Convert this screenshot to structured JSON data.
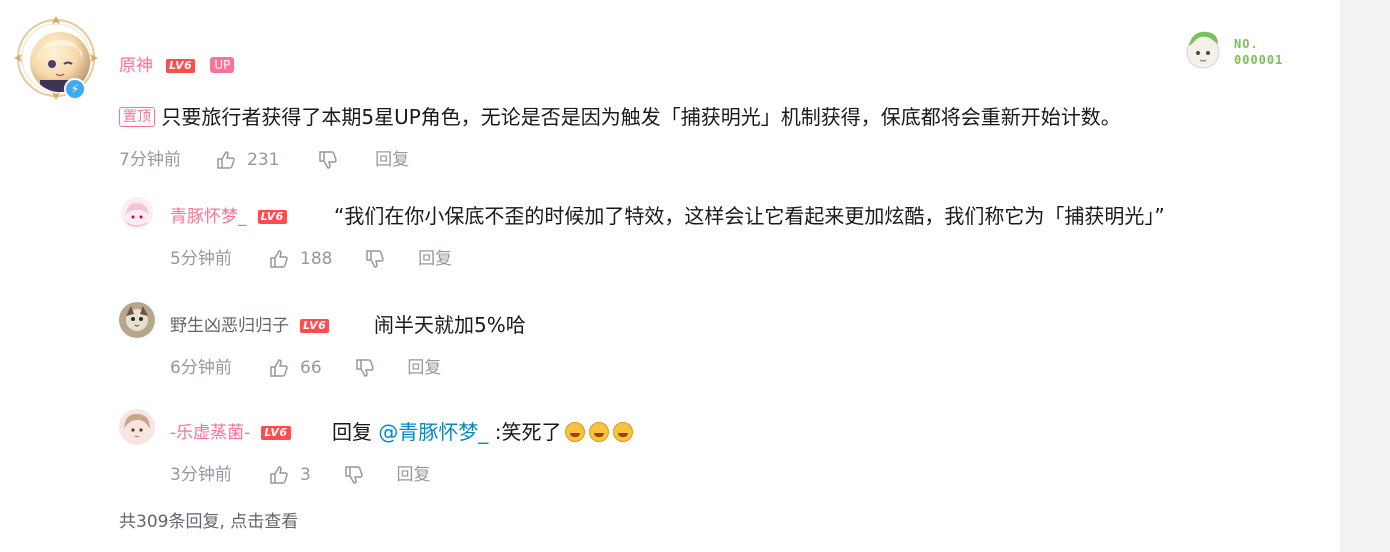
{
  "main_comment": {
    "username": "原神",
    "level": "LV6",
    "up_tag": "UP",
    "pin_label": "置顶",
    "text": "只要旅行者获得了本期5星UP角色，无论是否是因为触发「捕获明光」机制获得，保底都将会重新开始计数。",
    "time": "7分钟前",
    "likes": "231",
    "reply_label": "回复",
    "fan_badge": {
      "line1": "NO.",
      "line2": "000001"
    }
  },
  "replies": [
    {
      "username": "青豚怀梦_",
      "level": "LV6",
      "text": "“我们在你小保底不歪的时候加了特效，这样会让它看起来更加炫酷，我们称它为「捕获明光」”",
      "time": "5分钟前",
      "likes": "188",
      "reply_label": "回复",
      "name_color": "#fb7299"
    },
    {
      "username": "野生凶恶归归子",
      "level": "LV6",
      "text": "闹半天就加5%哈",
      "time": "6分钟前",
      "likes": "66",
      "reply_label": "回复",
      "name_color": "#61666d"
    },
    {
      "username": "-乐虚蒸菌-",
      "level": "LV6",
      "prefix": "回复 ",
      "mention": "@青豚怀梦_",
      "text": " :笑死了",
      "emoji_count": 3,
      "time": "3分钟前",
      "likes": "3",
      "reply_label": "回复",
      "name_color": "#fb7299"
    }
  ],
  "more_replies": "共309条回复, 点击查看",
  "colors": {
    "accent_pink": "#fb7299",
    "level_red": "#ff4c4c",
    "mention_blue": "#008ac5",
    "meta_gray": "#9499a0"
  }
}
